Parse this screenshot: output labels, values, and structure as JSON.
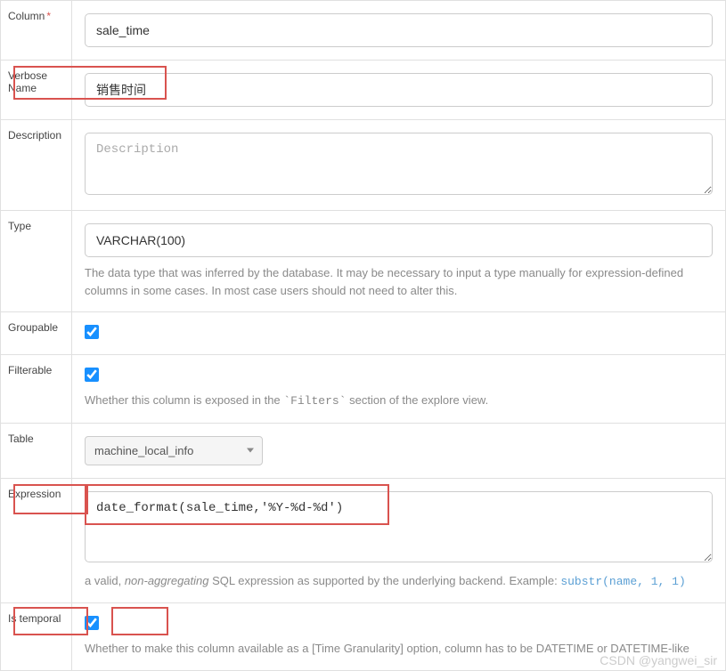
{
  "column": {
    "label": "Column",
    "value": "sale_time"
  },
  "verbose_name": {
    "label": "Verbose Name",
    "value": "销售时间"
  },
  "description": {
    "label": "Description",
    "placeholder": "Description",
    "value": ""
  },
  "type": {
    "label": "Type",
    "value": "VARCHAR(100)",
    "help": "The data type that was inferred by the database. It may be necessary to input a type manually for expression-defined columns in some cases. In most case users should not need to alter this."
  },
  "groupable": {
    "label": "Groupable",
    "checked": true
  },
  "filterable": {
    "label": "Filterable",
    "checked": true,
    "help_prefix": "Whether this column is exposed in the ",
    "help_code": "`Filters`",
    "help_suffix": " section of the explore view."
  },
  "table": {
    "label": "Table",
    "selected": "machine_local_info"
  },
  "expression": {
    "label": "Expression",
    "value": "date_format(sale_time,'%Y-%d-%d')",
    "help_prefix": "a valid, ",
    "help_em": "non-aggregating",
    "help_mid": " SQL expression as supported by the underlying backend. Example: ",
    "help_code": "substr(name, 1, 1)"
  },
  "is_temporal": {
    "label": "Is temporal",
    "checked": true,
    "help": "Whether to make this column available as a [Time Granularity] option, column has to be DATETIME or DATETIME-like"
  },
  "watermark": "CSDN @yangwei_sir"
}
